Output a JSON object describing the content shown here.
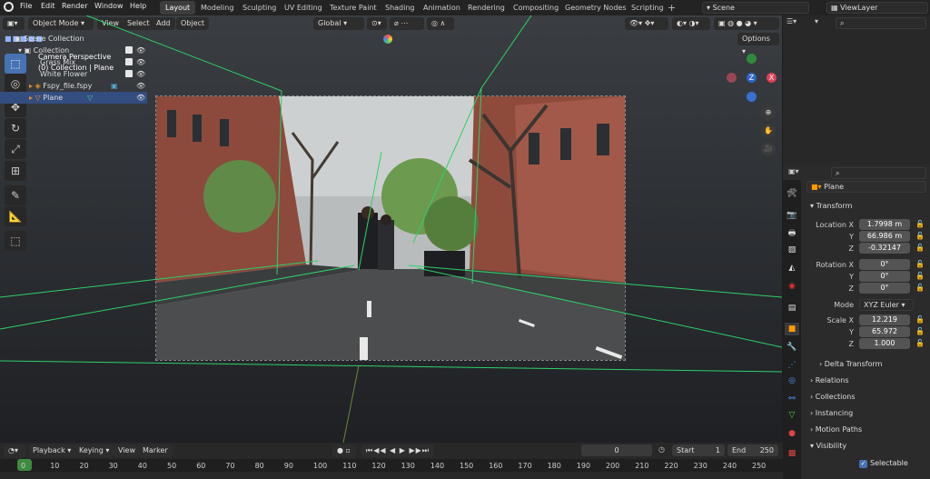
{
  "app": {
    "blender_icon": "blender-logo-icon"
  },
  "menu": [
    "File",
    "Edit",
    "Render",
    "Window",
    "Help"
  ],
  "workspaces": [
    "Layout",
    "Modeling",
    "Sculpting",
    "UV Editing",
    "Texture Paint",
    "Shading",
    "Animation",
    "Rendering",
    "Compositing",
    "Geometry Nodes",
    "Scripting"
  ],
  "active_workspace": "Layout",
  "scene": "Scene",
  "view_layer": "ViewLayer",
  "viewport": {
    "mode": "Object Mode",
    "menus": [
      "View",
      "Select",
      "Add",
      "Object"
    ],
    "orientation": "Global",
    "options": "Options",
    "camera_label": "Camera Perspective",
    "collection_label": "(0) Collection | Plane"
  },
  "gizmo": {
    "z": "Z",
    "y": "Y",
    "x": "X"
  },
  "outliner": {
    "rows": [
      {
        "label": "Scene Collection"
      },
      {
        "label": "Collection"
      },
      {
        "label": "Grass Mix"
      },
      {
        "label": "White Flower"
      },
      {
        "label": "Fspy_file.fspy"
      },
      {
        "label": "Plane"
      }
    ]
  },
  "properties": {
    "object_name": "Plane",
    "transform": "Transform",
    "location": {
      "label": "Location X",
      "x": "1.7998 m",
      "y": "66.986 m",
      "z": "-0.32147"
    },
    "rotation": {
      "label": "Rotation X",
      "x": "0°",
      "y": "0°",
      "z": "0°"
    },
    "mode": {
      "label": "Mode",
      "value": "XYZ Euler"
    },
    "scale": {
      "label": "Scale X",
      "x": "12.219",
      "y": "65.972",
      "z": "1.000"
    },
    "y_label": "Y",
    "z_label": "Z",
    "sections": [
      "Delta Transform",
      "Relations",
      "Collections",
      "Instancing",
      "Motion Paths",
      "Visibility"
    ],
    "selectable": "Selectable"
  },
  "timeline": {
    "menus": [
      "Playback",
      "Keying",
      "View",
      "Marker"
    ],
    "current_frame": "0",
    "start_label": "Start",
    "start": "1",
    "end_label": "End",
    "end": "250",
    "ticks": [
      "0",
      "10",
      "20",
      "30",
      "40",
      "50",
      "60",
      "70",
      "80",
      "90",
      "100",
      "110",
      "120",
      "130",
      "140",
      "150",
      "160",
      "170",
      "180",
      "190",
      "200",
      "210",
      "220",
      "230",
      "240",
      "250"
    ]
  },
  "colors": {
    "accent": "#4772b3",
    "green_line": "#2fd06a",
    "select": "#334d80"
  }
}
